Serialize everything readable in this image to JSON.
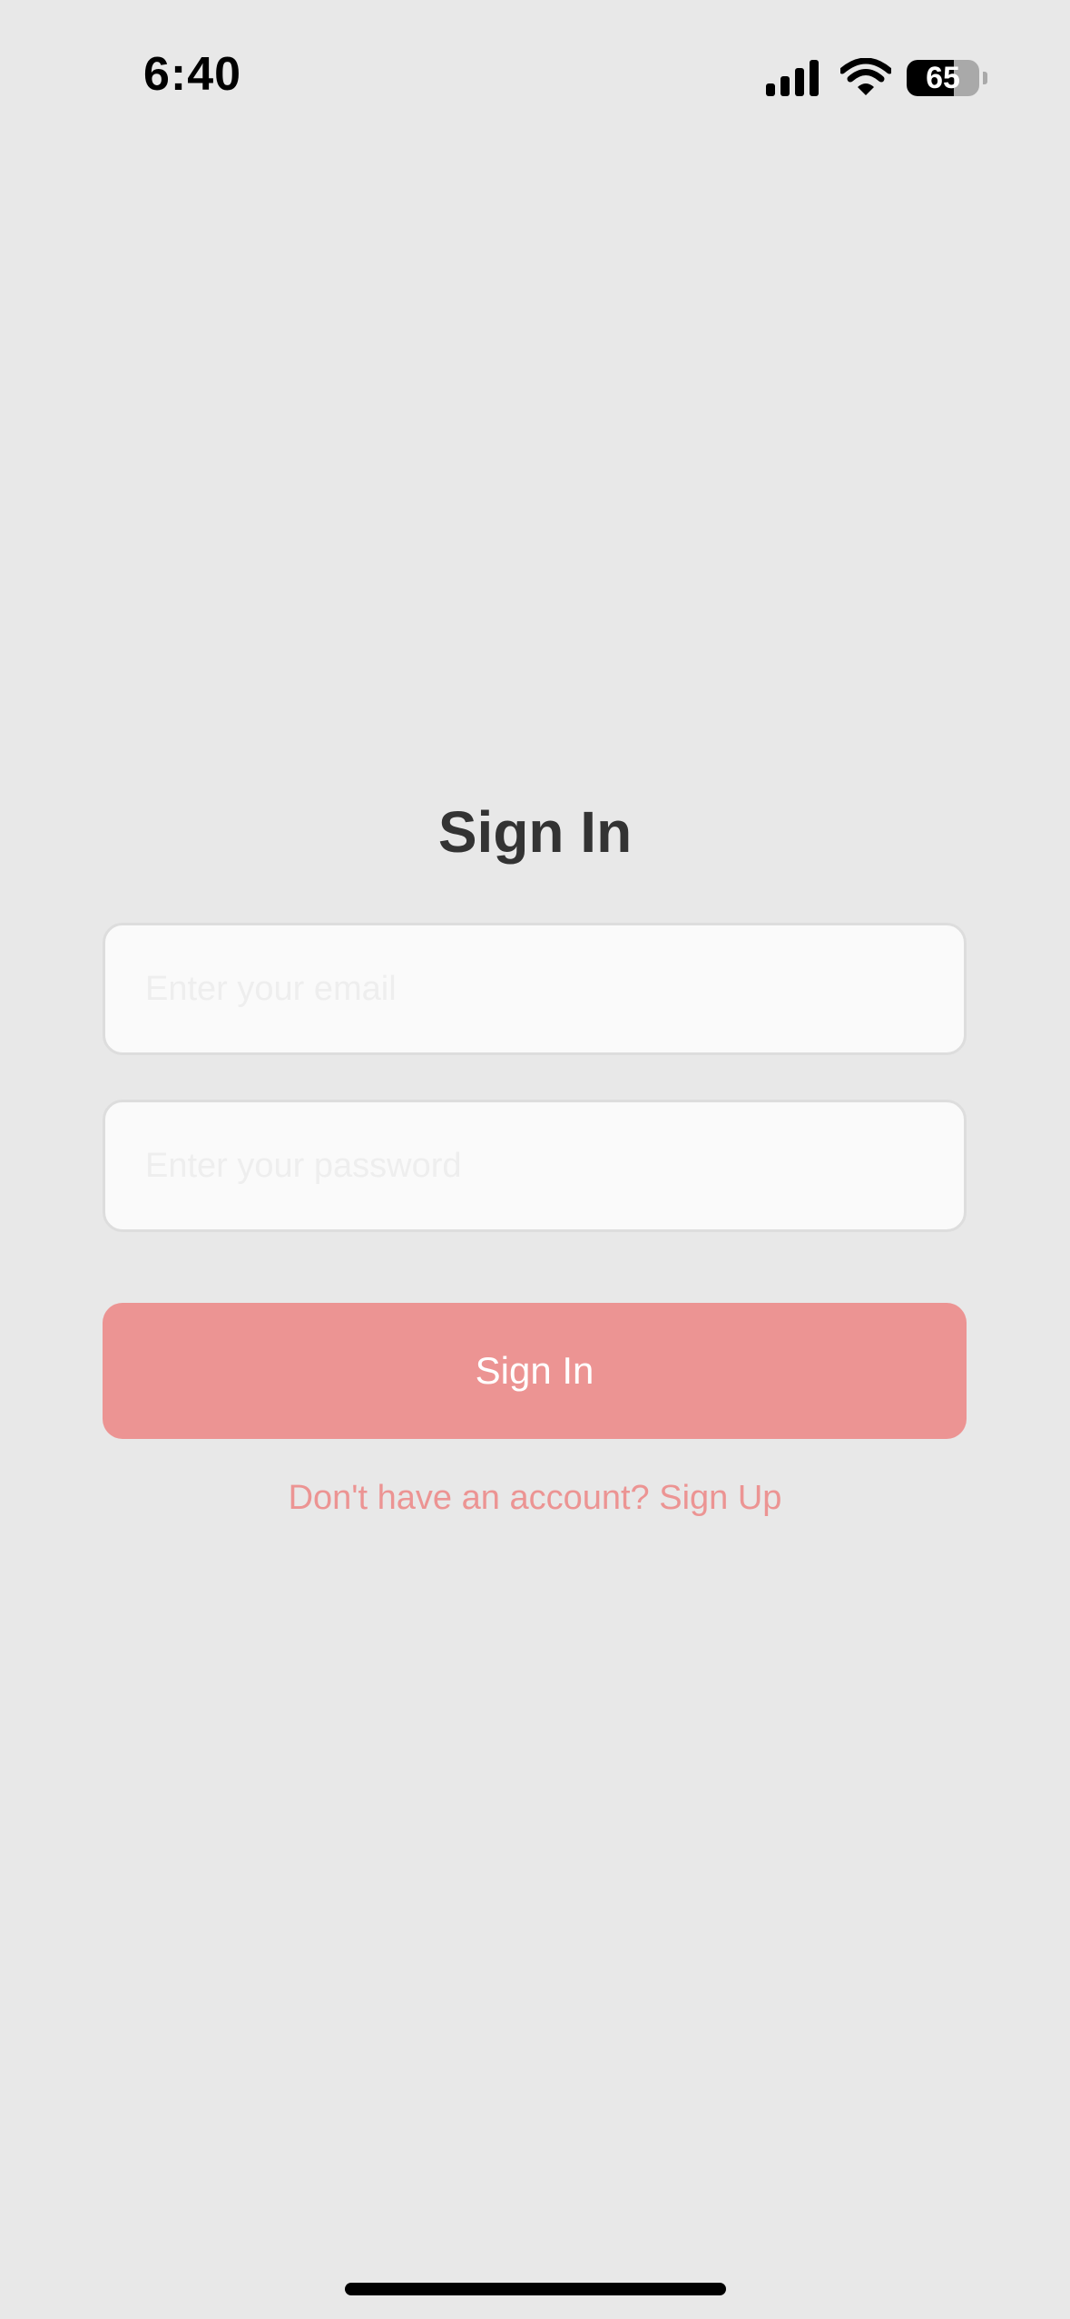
{
  "status_bar": {
    "time": "6:40",
    "battery_level": "65",
    "battery_fraction": 0.65,
    "icons": [
      "signal-icon",
      "wifi-icon",
      "battery-icon"
    ]
  },
  "main": {
    "title": "Sign In",
    "email_field": {
      "placeholder": "Enter your email",
      "value": ""
    },
    "password_field": {
      "placeholder": "Enter your password",
      "value": ""
    },
    "signin_button_label": "Sign In",
    "signup_link": "Don't have an account? Sign Up"
  },
  "colors": {
    "background": "#e8e8e8",
    "accent": "#ec9493",
    "title_text": "#333333",
    "input_background": "#fafafa",
    "input_border": "#dddddd"
  }
}
